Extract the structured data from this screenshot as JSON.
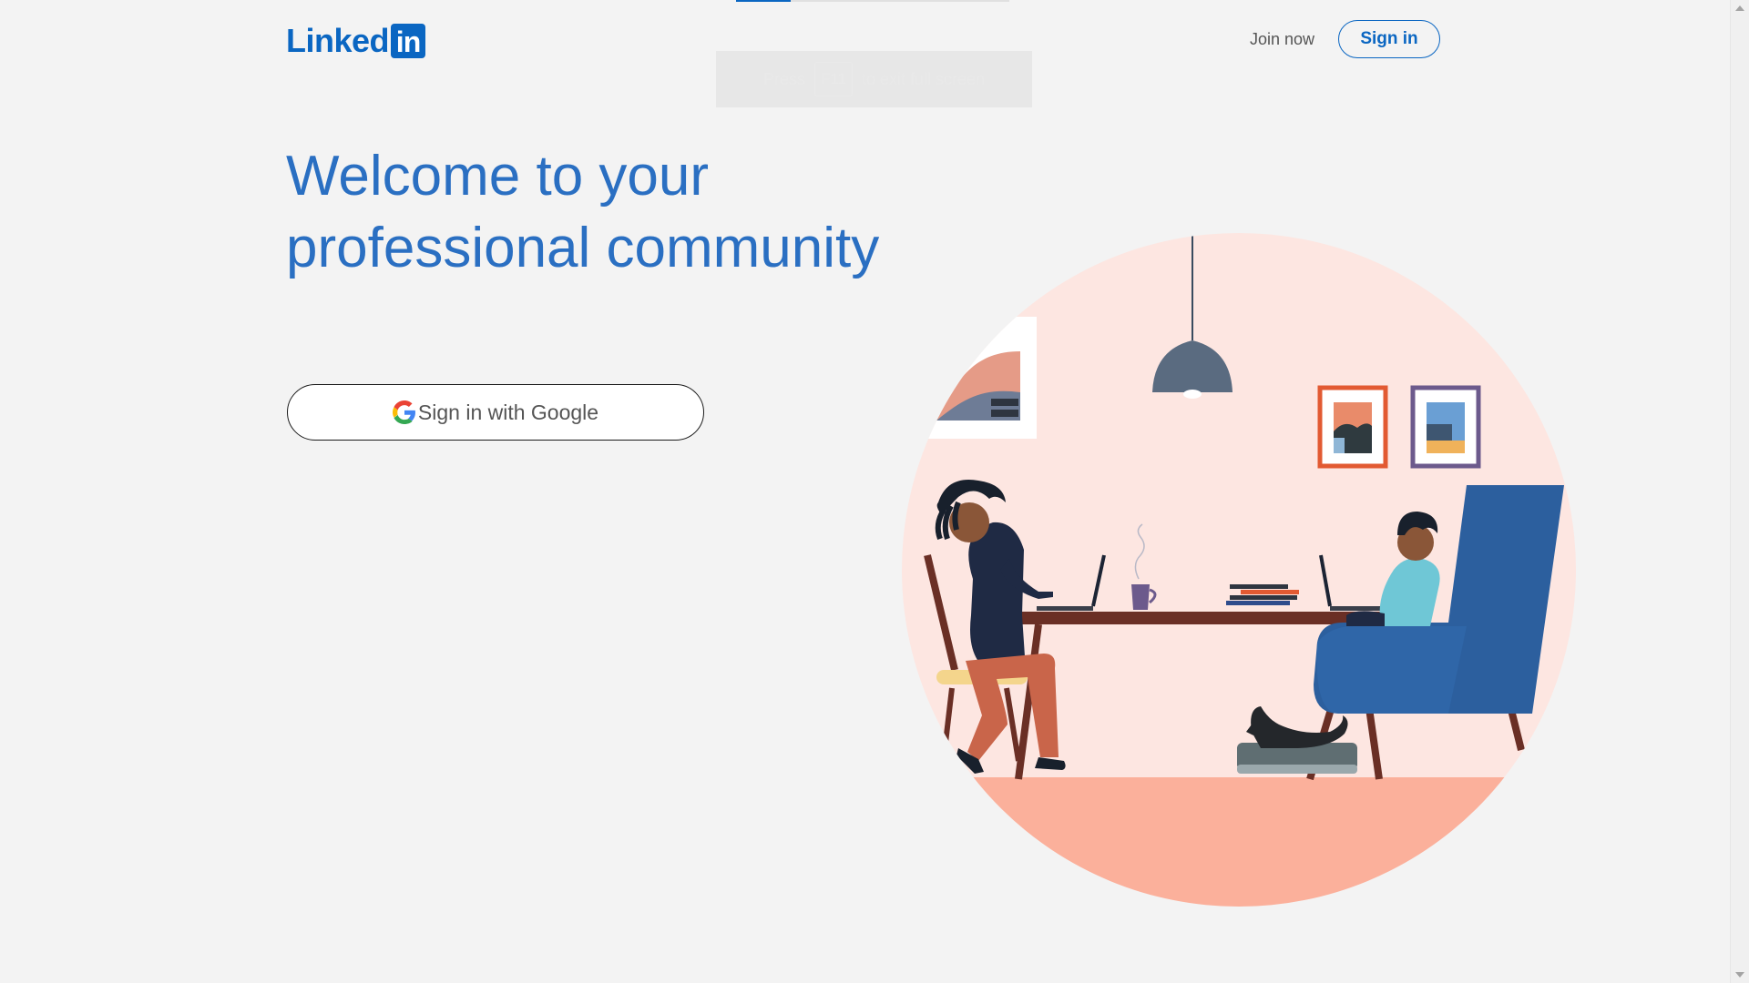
{
  "header": {
    "logo_text": "Linked",
    "logo_box_text": "in",
    "join_now_label": "Join now",
    "sign_in_label": "Sign in"
  },
  "fullscreen_toast": {
    "prefix": "Press",
    "key": "F11",
    "suffix": "to exit full screen"
  },
  "hero": {
    "headline_line1": "Welcome to your",
    "headline_line2": "professional community",
    "google_button_label": "Sign in with Google"
  },
  "colors": {
    "brand_blue": "#0a66c2",
    "headline_blue": "#2a6fc2",
    "page_background": "#f3f3f3",
    "illustration_circle": "#fde6e1",
    "illustration_floor": "#fbb09b"
  },
  "icons": {
    "google": "google-g-icon",
    "scroll_up": "scroll-up-arrow-icon",
    "scroll_down": "scroll-down-arrow-icon"
  }
}
